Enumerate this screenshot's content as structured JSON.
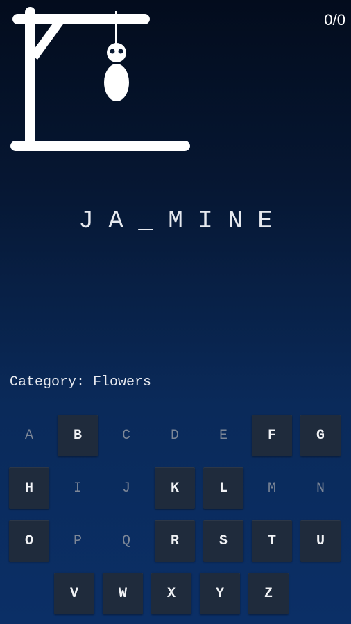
{
  "score": "0/0",
  "word": [
    "J",
    "A",
    "_",
    "M",
    "I",
    "N",
    "E"
  ],
  "category": "Category: Flowers",
  "keyboard": {
    "rows": [
      [
        {
          "letter": "A",
          "used": true
        },
        {
          "letter": "B",
          "used": false
        },
        {
          "letter": "C",
          "used": true
        },
        {
          "letter": "D",
          "used": true
        },
        {
          "letter": "E",
          "used": true
        },
        {
          "letter": "F",
          "used": false
        },
        {
          "letter": "G",
          "used": false
        }
      ],
      [
        {
          "letter": "H",
          "used": false
        },
        {
          "letter": "I",
          "used": true
        },
        {
          "letter": "J",
          "used": true
        },
        {
          "letter": "K",
          "used": false
        },
        {
          "letter": "L",
          "used": false
        },
        {
          "letter": "M",
          "used": true
        },
        {
          "letter": "N",
          "used": true
        }
      ],
      [
        {
          "letter": "O",
          "used": false
        },
        {
          "letter": "P",
          "used": true
        },
        {
          "letter": "Q",
          "used": true
        },
        {
          "letter": "R",
          "used": false
        },
        {
          "letter": "S",
          "used": false
        },
        {
          "letter": "T",
          "used": false
        },
        {
          "letter": "U",
          "used": false
        }
      ],
      [
        {
          "letter": "V",
          "used": false
        },
        {
          "letter": "W",
          "used": false
        },
        {
          "letter": "X",
          "used": false
        },
        {
          "letter": "Y",
          "used": false
        },
        {
          "letter": "Z",
          "used": false
        }
      ]
    ]
  },
  "hangman_parts_shown": [
    "head",
    "body"
  ]
}
